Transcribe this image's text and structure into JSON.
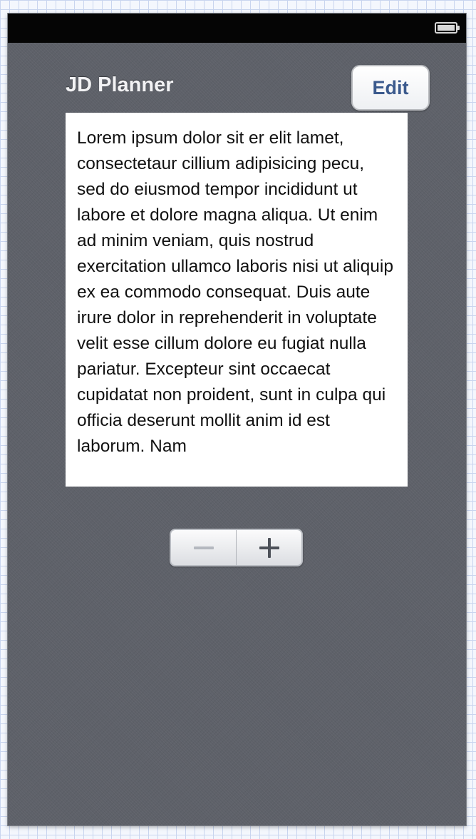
{
  "nav": {
    "title": "JD Planner",
    "edit_label": "Edit"
  },
  "status_bar": {
    "battery_icon": "battery-full-icon"
  },
  "text_view": {
    "content": "Lorem ipsum dolor sit er elit lamet, consectetaur cillium adipisicing pecu, sed do eiusmod tempor incididunt ut labore et dolore magna aliqua. Ut enim ad minim veniam, quis nostrud exercitation ullamco laboris nisi ut aliquip ex ea commodo consequat. Duis aute irure dolor in reprehenderit in voluptate velit esse cillum dolore eu fugiat nulla pariatur. Excepteur sint occaecat cupidatat non proident, sunt in culpa qui officia deserunt mollit anim id est laborum. Nam"
  },
  "stepper": {
    "decrement_icon": "minus-icon",
    "increment_icon": "plus-icon"
  },
  "colors": {
    "background": "#5e6169",
    "status_bar": "#050505",
    "edit_text": "#3b5a8d",
    "title_text": "#f2f2f4"
  }
}
